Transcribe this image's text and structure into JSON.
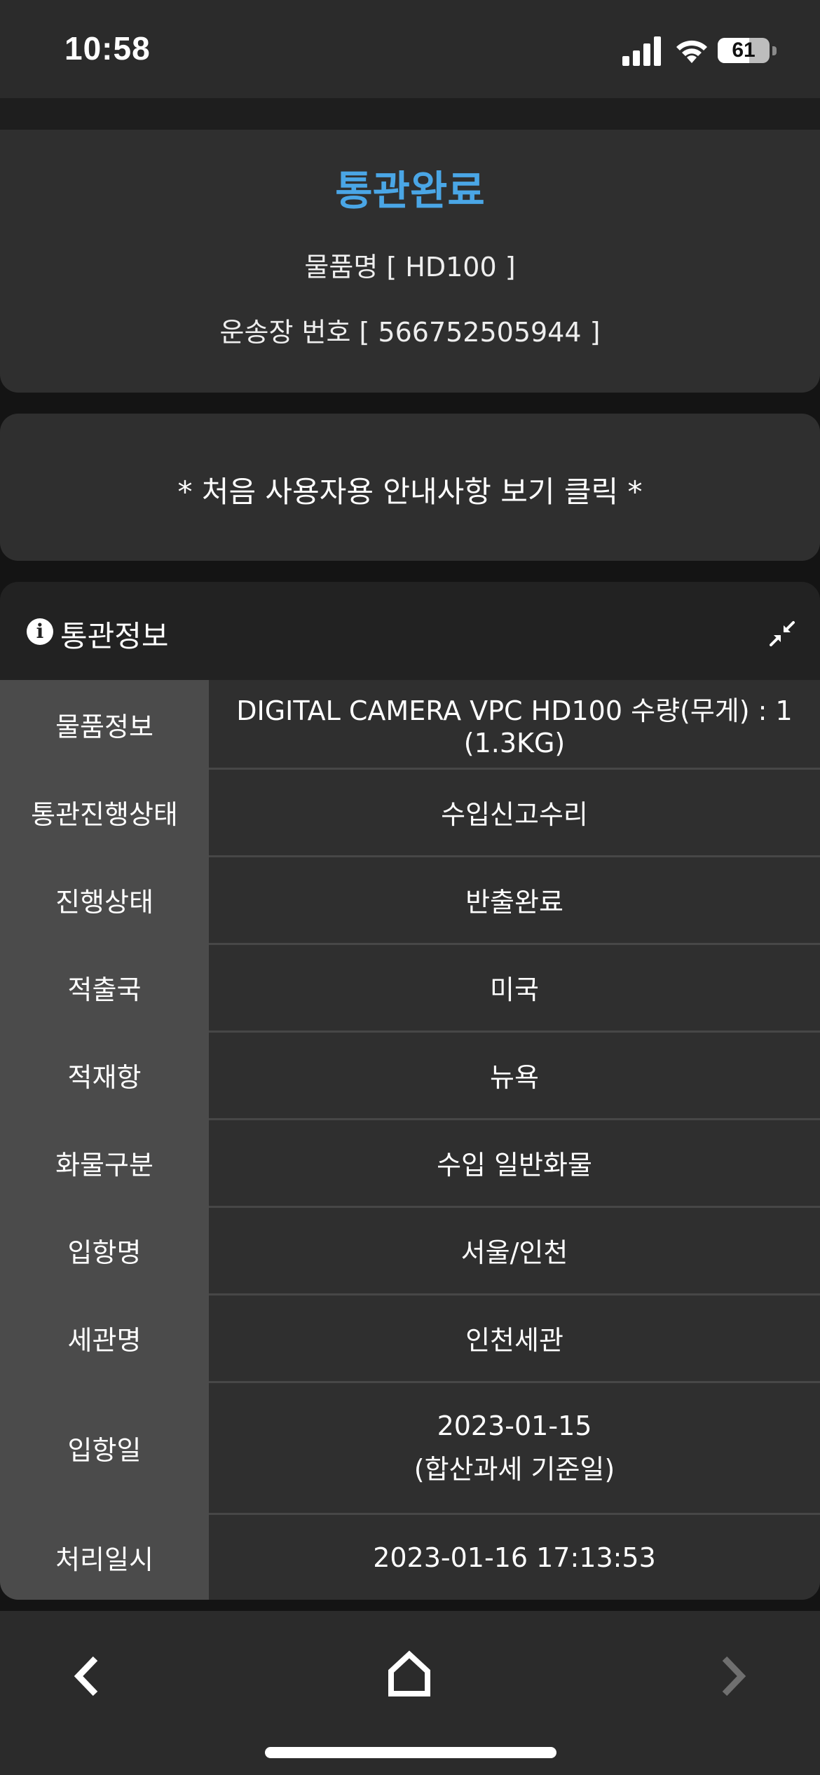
{
  "status_bar": {
    "time": "10:58",
    "battery_level": "61",
    "battery_fraction": 0.61,
    "icons": [
      "signal-icon",
      "wifi-icon",
      "battery-icon"
    ]
  },
  "summary": {
    "status": "통관완료",
    "item_line": "물품명 [ HD100 ]",
    "tracking_line": "운송장 번호 [ 566752505944 ]",
    "status_color": "#4aa6e6"
  },
  "guide": {
    "text": "* 처음 사용자용 안내사항 보기 클릭 *"
  },
  "info": {
    "title": "통관정보",
    "rows": [
      {
        "label": "물품정보",
        "value": "DIGITAL CAMERA VPC HD100 수량(무게) : 1 (1.3KG)"
      },
      {
        "label": "통관진행상태",
        "value": "수입신고수리"
      },
      {
        "label": "진행상태",
        "value": "반출완료"
      },
      {
        "label": "적출국",
        "value": "미국"
      },
      {
        "label": "적재항",
        "value": "뉴욕"
      },
      {
        "label": "화물구분",
        "value": "수입 일반화물"
      },
      {
        "label": "입항명",
        "value": "서울/인천"
      },
      {
        "label": "세관명",
        "value": "인천세관"
      },
      {
        "label": "입항일",
        "value": "2023-01-15",
        "value_note": "(합산과세 기준일)"
      },
      {
        "label": "처리일시",
        "value": "2023-01-16 17:13:53"
      }
    ]
  },
  "bottom_nav": {
    "icons": [
      "back-icon",
      "home-icon",
      "forward-icon"
    ]
  }
}
